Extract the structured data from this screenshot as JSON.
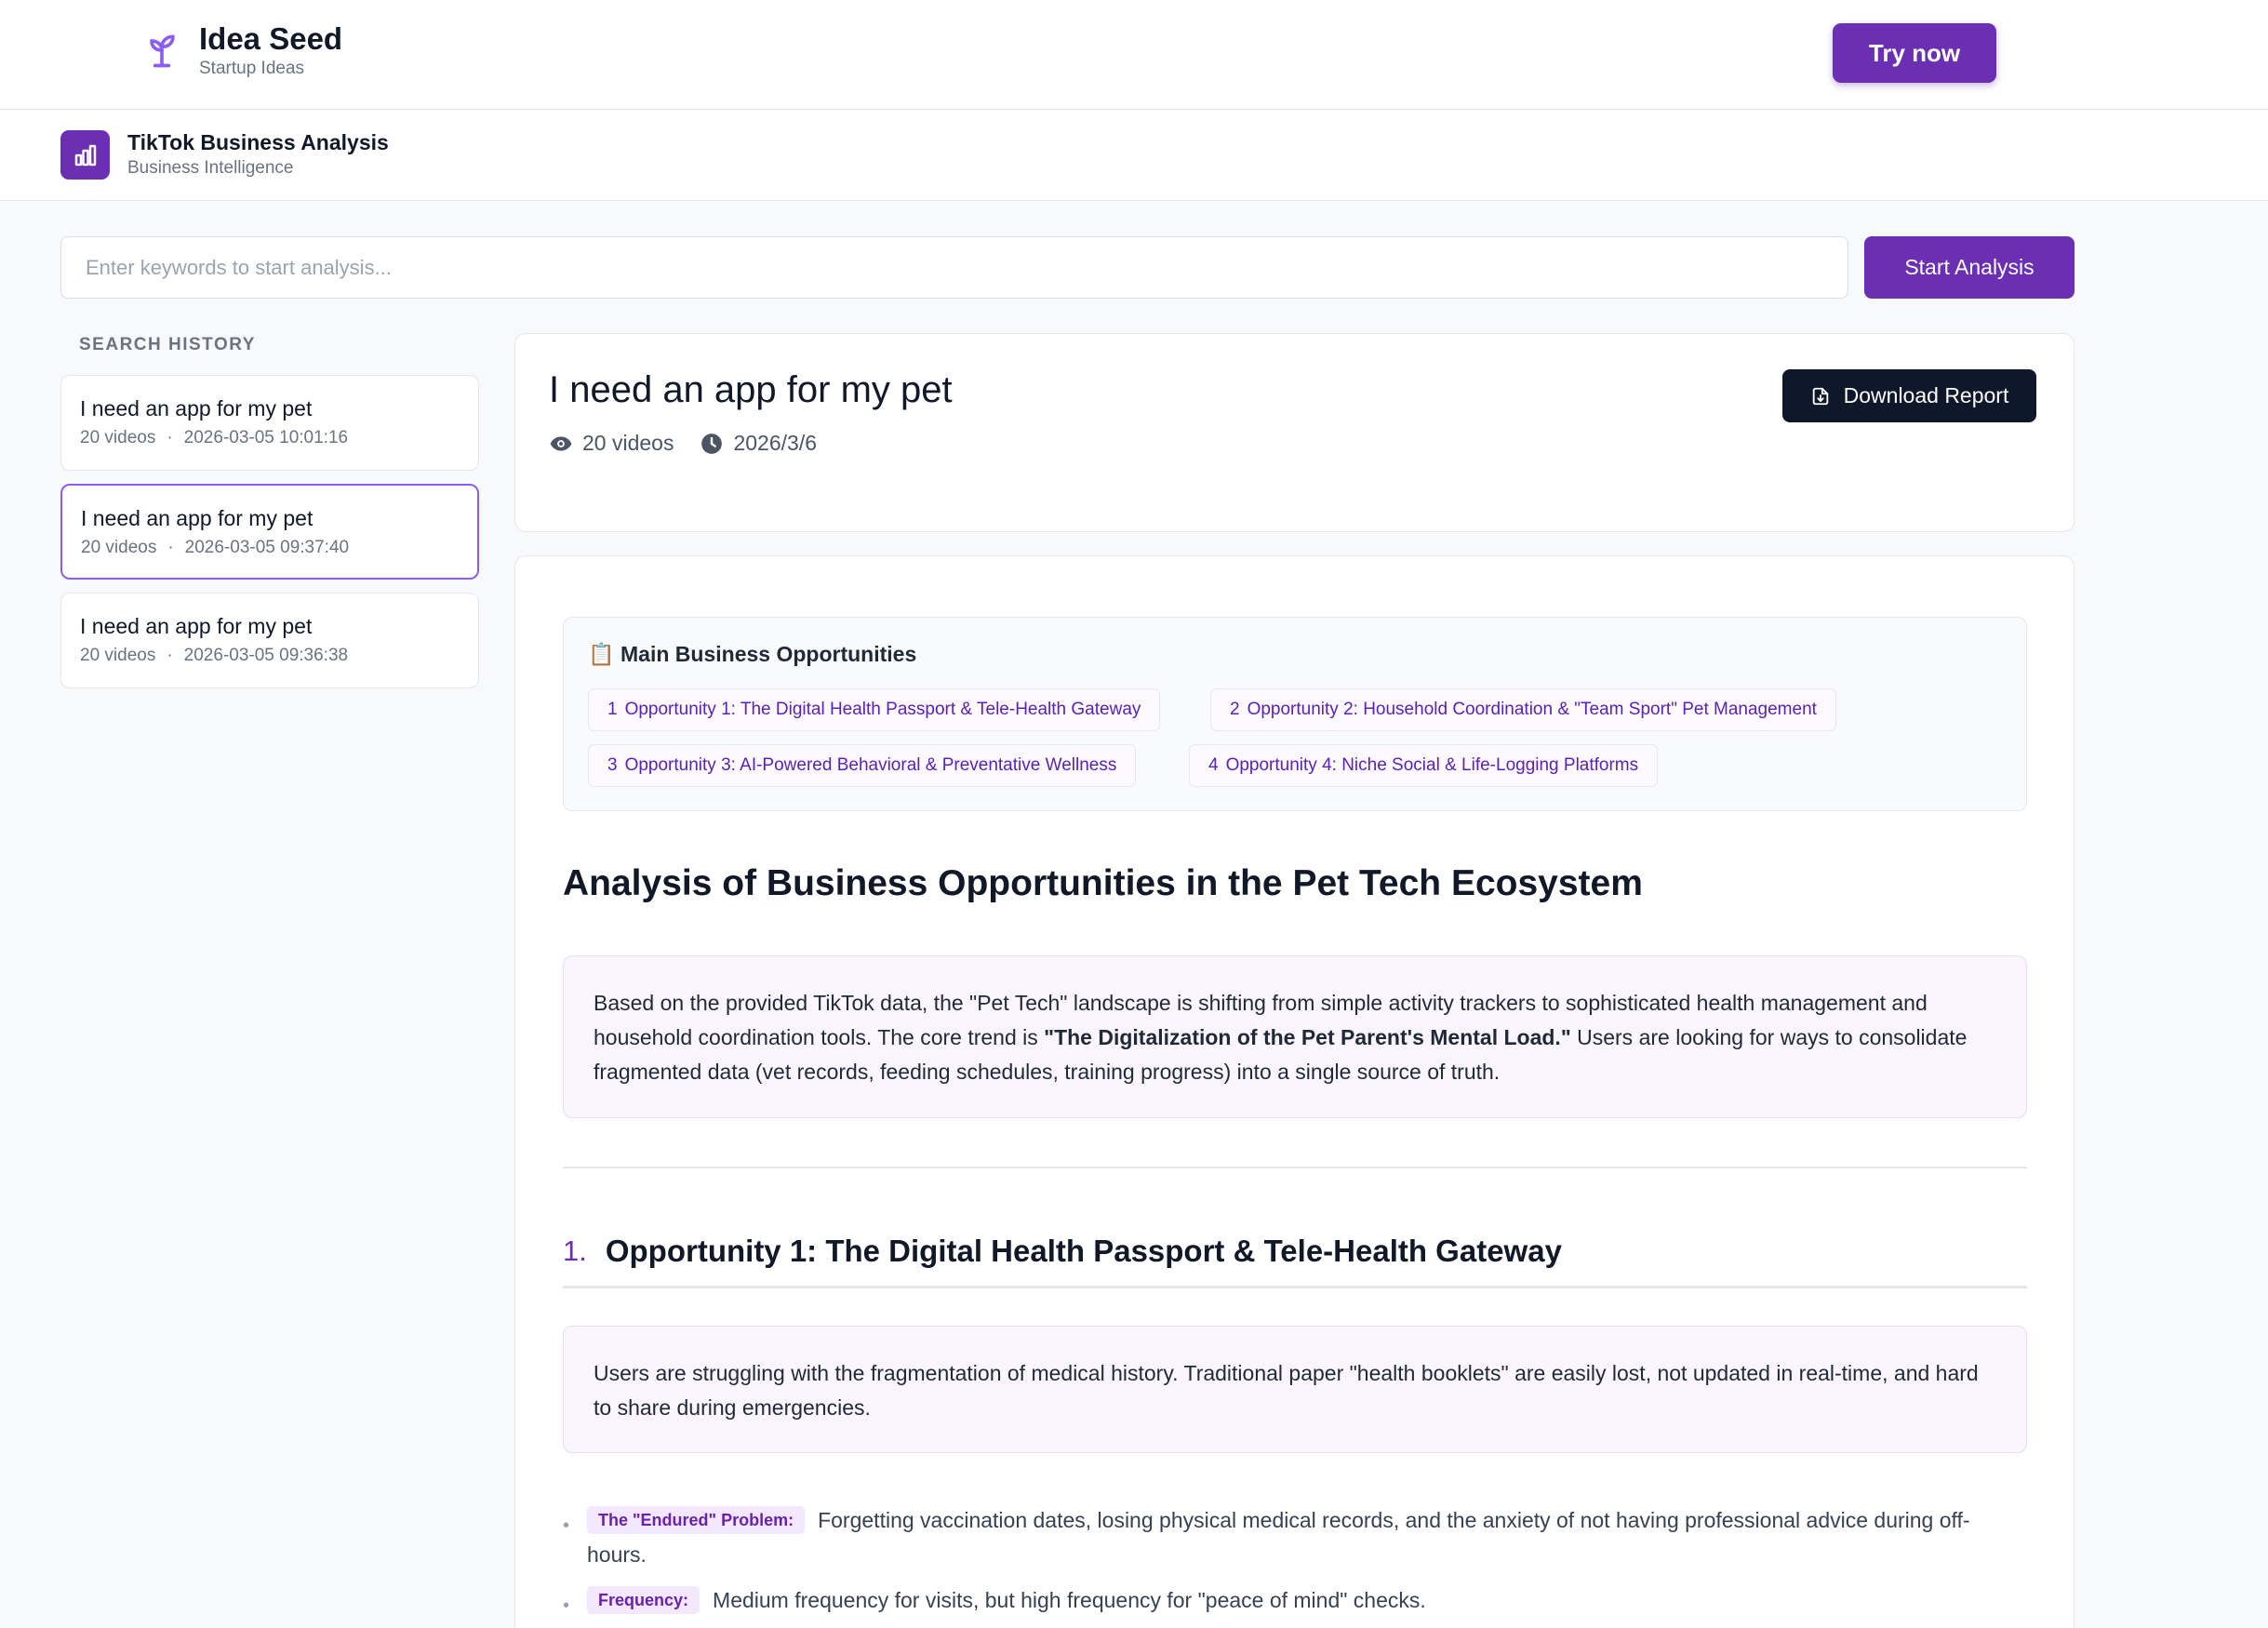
{
  "brand": {
    "title": "Idea Seed",
    "subtitle": "Startup Ideas",
    "icon": "sprout-icon"
  },
  "header": {
    "try_label": "Try now"
  },
  "app": {
    "title": "TikTok Business Analysis",
    "subtitle": "Business Intelligence",
    "icon": "bar-chart-icon"
  },
  "search": {
    "placeholder": "Enter keywords to start analysis...",
    "value": "",
    "button_label": "Start Analysis"
  },
  "history": {
    "title": "SEARCH HISTORY",
    "items": [
      {
        "title": "I need an app for my pet",
        "videos": "20 videos",
        "date": "2026-03-05 10:01:16",
        "active": false
      },
      {
        "title": "I need an app for my pet",
        "videos": "20 videos",
        "date": "2026-03-05 09:37:40",
        "active": true
      },
      {
        "title": "I need an app for my pet",
        "videos": "20 videos",
        "date": "2026-03-05 09:36:38",
        "active": false
      }
    ]
  },
  "result": {
    "title": "I need an app for my pet",
    "videos": "20 videos",
    "date": "2026/3/6",
    "download_label": "Download Report"
  },
  "report": {
    "opportunities_title": "📋 Main Business Opportunities",
    "chips": [
      {
        "num": "1",
        "label": "Opportunity 1: The Digital Health Passport & Tele-Health Gateway"
      },
      {
        "num": "2",
        "label": "Opportunity 2: Household Coordination & \"Team Sport\" Pet Management"
      },
      {
        "num": "3",
        "label": "Opportunity 3: AI-Powered Behavioral & Preventative Wellness"
      },
      {
        "num": "4",
        "label": "Opportunity 4: Niche Social & Life-Logging Platforms"
      }
    ],
    "section_title": "Analysis of Business Opportunities in the Pet Tech Ecosystem",
    "summary": {
      "before": "Based on the provided TikTok data, the \"Pet Tech\" landscape is shifting from simple activity trackers to sophisticated health management and household coordination tools. The core trend is ",
      "bold": "\"The Digitalization of the Pet Parent's Mental Load.\"",
      "after": " Users are looking for ways to consolidate fragmented data (vet records, feeding schedules, training progress) into a single source of truth."
    },
    "opp1": {
      "num": "1.",
      "title": "Opportunity 1: The Digital Health Passport & Tele-Health Gateway",
      "desc": "Users are struggling with the fragmentation of medical history. Traditional paper \"health booklets\" are easily lost, not updated in real-time, and hard to share during emergencies.",
      "bullets": [
        {
          "tag": "The \"Endured\" Problem:",
          "text": "Forgetting vaccination dates, losing physical medical records, and the anxiety of not having professional advice during off-hours."
        },
        {
          "tag": "Frequency:",
          "text": "Medium frequency for visits, but high frequency for \"peace of mind\" checks."
        }
      ]
    }
  },
  "colors": {
    "accent": "#6b2fb3",
    "dark_button": "#0f172a",
    "tint": "#faf5ff"
  }
}
